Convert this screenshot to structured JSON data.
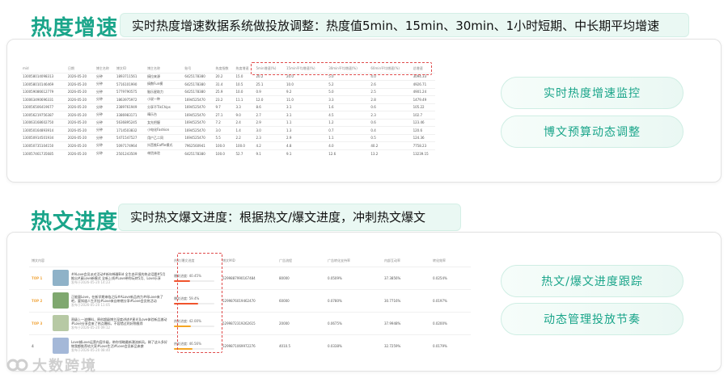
{
  "section1": {
    "title": "热度增速",
    "headline": "实时热度增速数据系统做投放调整：热度值5min、15min、30min、1小时短期、中长期平均增速",
    "pills": [
      "实时热度增速监控",
      "博文预算动态调整"
    ],
    "table": {
      "headers": [
        "mid",
        "日期",
        "博主名称",
        "博文ID",
        "博主名称",
        "账号",
        "热度指数",
        "热度增速",
        "5min增速(%)",
        "15min平均增速(%)",
        "30min平均增速(%)",
        "60min平均增速(%)",
        "总增速"
      ],
      "rows": [
        [
          "130058014098313",
          "2026-05-20",
          "分钟",
          "1893711561",
          "搞拉来源",
          "6425178380",
          "20.2",
          "15.0",
          "20.2",
          "20.0",
          "5.0",
          "4.0",
          "3094.33"
        ],
        [
          "130058010146469",
          "2026-05-20",
          "分钟",
          "5716101990",
          "搞数Fun模",
          "6425178380",
          "31.4",
          "10.5",
          "25.1",
          "10.0",
          "5.2",
          "2.6",
          "4926.71"
        ],
        [
          "130059086612779",
          "2026-05-20",
          "分钟",
          "5779790575",
          "脑乐星助力",
          "6425178380",
          "25.9",
          "10.0",
          "0.9",
          "9.2",
          "5.0",
          "2.5",
          "4901.24"
        ],
        [
          "130063490696331",
          "2026-05-20",
          "分钟",
          "1863975972",
          "小说一种",
          "1694525470",
          "23.2",
          "11.1",
          "12.0",
          "11.0",
          "3.3",
          "2.8",
          "1479.49"
        ],
        [
          "130056506419677",
          "2026-05-20",
          "分钟",
          "2389761949",
          "分享不TikChips",
          "1694525470",
          "9.7",
          "3.3",
          "8.6",
          "3.1",
          "1.6",
          "0.6",
          "105.22"
        ],
        [
          "130056219756387",
          "2026-05-20",
          "分钟",
          "3386983171",
          "晴乐台",
          "1694525470",
          "27.1",
          "9.0",
          "2.7",
          "3.1",
          "4.5",
          "2.3",
          "102.7"
        ],
        [
          "130063168602750",
          "2026-05-20",
          "分钟",
          "5636895245",
          "女先把握",
          "1694525470",
          "7.2",
          "2.4",
          "2.9",
          "1.1",
          "1.2",
          "0.6",
          "123.46"
        ],
        [
          "130050164893914",
          "2026-05-20",
          "分钟",
          "1714503832",
          "小电化Fashion",
          "1694525470",
          "3.0",
          "1.4",
          "3.0",
          "1.3",
          "0.7",
          "0.4",
          "120.6"
        ],
        [
          "130050914501934",
          "2026-05-20",
          "分钟",
          "5471547527",
          "用户乙二同",
          "1694525470",
          "5.5",
          "2.2",
          "2.3",
          "2.9",
          "1.1",
          "0.5",
          "124.36"
        ],
        [
          "130050735104150",
          "2026-05-20",
          "分钟",
          "5097174964",
          "抖音推Eaffie模式",
          "7962560941",
          "100.0",
          "100.0",
          "4.2",
          "4.8",
          "4.0",
          "40.2",
          "7758.23"
        ],
        [
          "130057461735685",
          "2026-05-20",
          "分钟",
          "2501243509",
          "带货体验",
          "6425178380",
          "100.0",
          "52.7",
          "9.1",
          "9.1",
          "12.6",
          "13.2",
          "13239.15"
        ]
      ]
    }
  },
  "section2": {
    "title": "热文进度",
    "headline": "实时热文爆文进度：根据热文/爆文进度，冲刺热文爆文",
    "pills": [
      "热文/爆文进度跟踪",
      "动态管理投放节奏"
    ],
    "table": {
      "headers": [
        "博文内容",
        "",
        "热文/爆文进度",
        "博文MID",
        "广告流程",
        "广告转化支持率",
        "内部互动率",
        "转化效率"
      ],
      "rows": [
        {
          "rank": "TOP 1",
          "thumb_color": "#8fb2c8",
          "text": "#ALove会员派对活动#新年畅聊Bid 全生态环境的热议话题#5月推出#真Love新模式 全新上线#Love带你玩转5月、Love乐享",
          "meta": "发布于2026-05-20 14:23",
          "progress_label": "爆文进度: 40.45%",
          "progress": 40.45,
          "bar_color": "#f0542d",
          "mid": "5299887990167484",
          "ad_flow": "80000",
          "ad_conv": "0.0509%",
          "interact": "37.3856%",
          "efficiency": "0.0254%"
        },
        {
          "rank": "TOP 2",
          "thumb_color": "#7fa86f",
          "text": "正能量Love，在新学期来临之际#ALove新品热力#吗Love来了吧，要知道人生开挂#Love来自带燃分享#Love会员热活动",
          "meta": "发布于2026-05-20 11:05",
          "progress_label": "爆文进度: 59.4%",
          "progress": 59.4,
          "bar_color": "#f0542d",
          "mid": "5299876019462470",
          "ad_flow": "60000",
          "ad_conv": "0.0780%",
          "interact": "30.7716%",
          "efficiency": "0.0197%"
        },
        {
          "rank": "TOP 3",
          "thumb_color": "#b7c9a4",
          "text": "晋级上一波爆料，原创超级博主深度讲述#星光]Love体验新品激动#Love分享会来了热点爆料，不容错过的好物推荐",
          "meta": "发布于2026-05-20 09:12",
          "progress_label": "热文进度: 42.00%",
          "progress": 42.0,
          "bar_color": "#f5a623",
          "mid": "5299872319262615",
          "ad_flow": "20000",
          "ad_conv": "0.0675%",
          "interact": "37.9948%",
          "efficiency": "0.0200%"
        },
        {
          "rank": "4",
          "thumb_color": "#a4b8d8",
          "text": "Love城Love运营内容升级，带你领略最新潮流新风。稀了这么多好物我都推荐给大家#Love生活#Love会员新品来袭",
          "meta": "发布于2026-05-20 08:40",
          "progress_label": "热文进度: 46.56%",
          "progress": 46.56,
          "bar_color": "#f5a623",
          "mid": "5299871069972276",
          "ad_flow": "4010.5",
          "ad_conv": "0.0338%",
          "interact": "32.7259%",
          "efficiency": "0.0179%"
        }
      ]
    }
  },
  "brand": {
    "name": "大数跨境"
  }
}
